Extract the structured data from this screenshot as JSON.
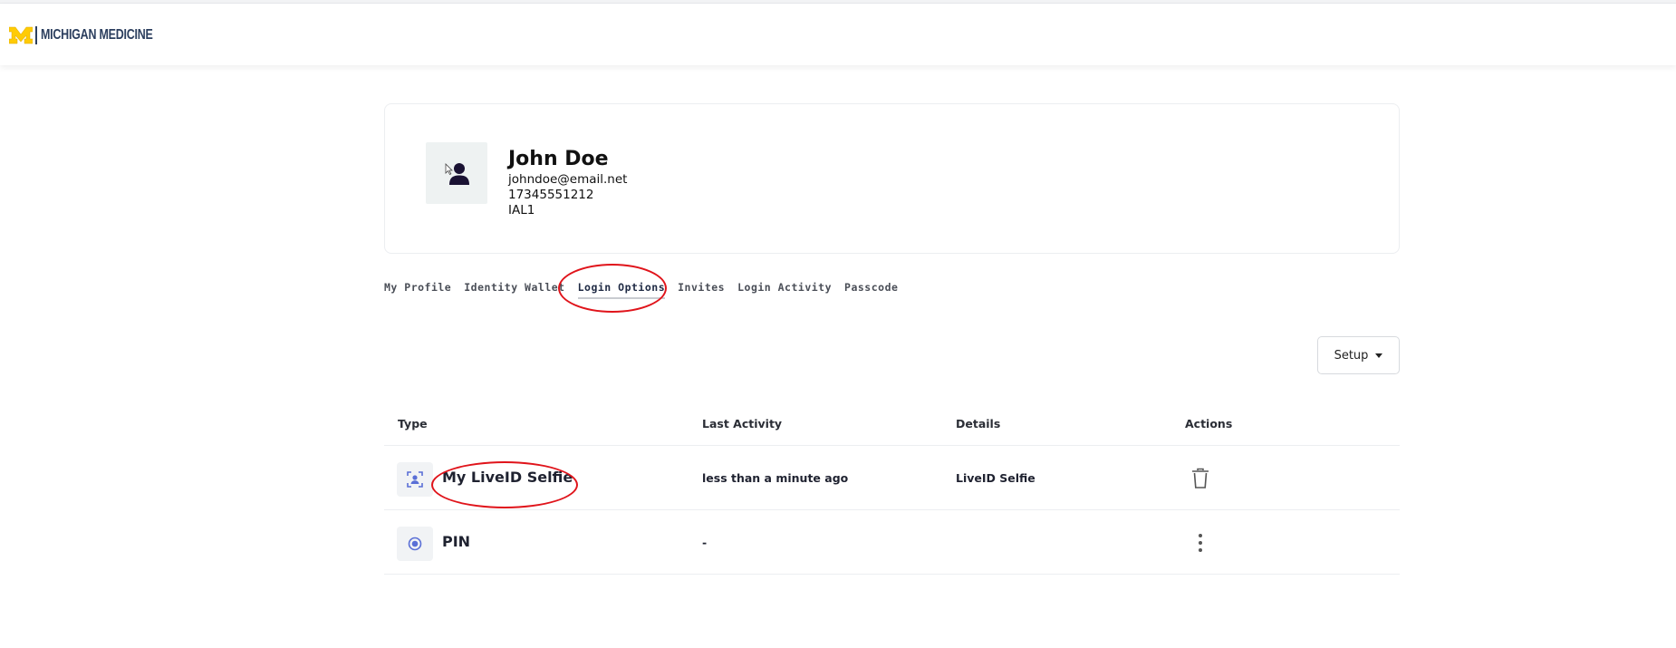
{
  "header": {
    "logo_text": "MICHIGAN MEDICINE",
    "logo_icon": "block-m-logo"
  },
  "profile": {
    "name": "John Doe",
    "email": "johndoe@email.net",
    "phone": "17345551212",
    "level": "IAL1",
    "avatar_icon": "user-silhouette-icon"
  },
  "tabs": [
    {
      "label": "My Profile",
      "active": false
    },
    {
      "label": "Identity Wallet",
      "active": false
    },
    {
      "label": "Login Options",
      "active": true
    },
    {
      "label": "Invites",
      "active": false
    },
    {
      "label": "Login Activity",
      "active": false
    },
    {
      "label": "Passcode",
      "active": false
    }
  ],
  "setup": {
    "label": "Setup"
  },
  "table": {
    "columns": [
      "Type",
      "Last Activity",
      "Details",
      "Actions"
    ],
    "rows": [
      {
        "type": "My LiveID Selfie",
        "icon": "face-scan-icon",
        "last_activity": "less than a minute ago",
        "details": "LiveID Selfie",
        "action_icon": "trash-icon"
      },
      {
        "type": "PIN",
        "icon": "radio-dot-icon",
        "last_activity": "-",
        "details": "",
        "action_icon": "kebab-menu-icon"
      }
    ]
  },
  "colors": {
    "annotation": "#e0141b",
    "brand_maize": "#ffcb05",
    "brand_blue": "#2b3e5e",
    "icon_blue": "#5a6fd6"
  }
}
